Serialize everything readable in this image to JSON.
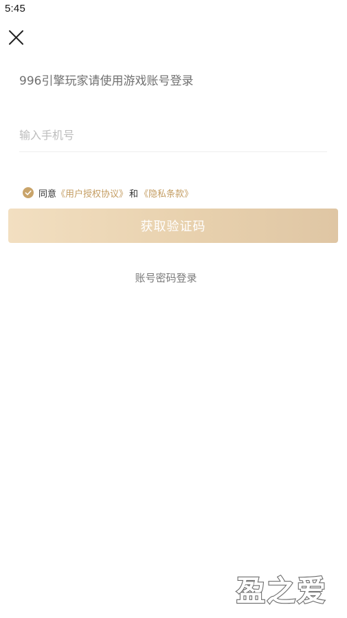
{
  "status_bar": {
    "time": "5:45"
  },
  "header": {
    "close_icon": "close-icon"
  },
  "login": {
    "subtitle": "996引擎玩家请使用游戏账号登录",
    "phone_placeholder": "输入手机号",
    "phone_value": "",
    "agree_prefix": "同意",
    "user_agreement": "《用户授权协议》",
    "and_text": "和",
    "privacy_policy": "《隐私条款》",
    "agreement_checked": true,
    "get_code_label": "获取验证码",
    "account_login_label": "账号密码登录"
  },
  "watermark": {
    "text": "盈之爱"
  },
  "colors": {
    "accent": "#c49d62",
    "check_fill": "#c9a46a",
    "button_start": "#f2dfc1",
    "button_end": "#dfc6a4"
  }
}
